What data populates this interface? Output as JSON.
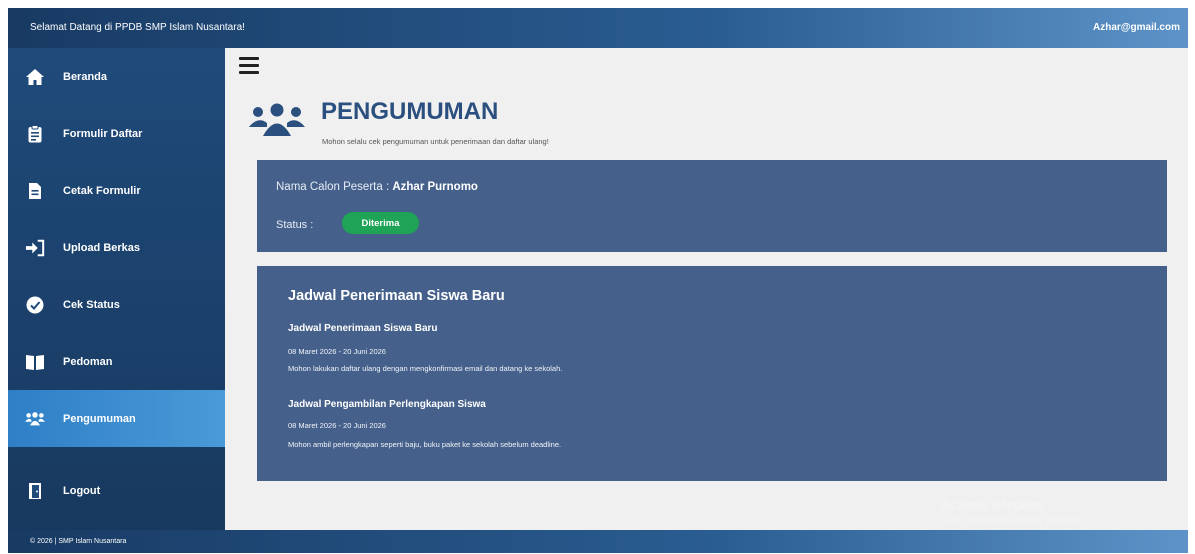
{
  "topbar": {
    "welcome": "Selamat Datang di PPDB SMP Islam Nusantara!",
    "email": "Azhar@gmail.com"
  },
  "sidebar": {
    "items": [
      {
        "label": "Beranda",
        "icon": "home-icon"
      },
      {
        "label": "Formulir Daftar",
        "icon": "form-icon"
      },
      {
        "label": "Cetak Formulir",
        "icon": "document-icon"
      },
      {
        "label": "Upload Berkas",
        "icon": "sign-in-icon"
      },
      {
        "label": "Cek Status",
        "icon": "check-circle-icon"
      },
      {
        "label": "Pedoman",
        "icon": "book-icon"
      },
      {
        "label": "Pengumuman",
        "icon": "users-icon",
        "active": true
      },
      {
        "label": "Logout",
        "icon": "door-icon"
      }
    ]
  },
  "header": {
    "title": "PENGUMUMAN",
    "subtitle": "Mohon selalu cek pengumuman untuk penerimaan dan daftar ulang!"
  },
  "applicant": {
    "name_label": "Nama Calon Peserta : ",
    "name": "Azhar Purnomo",
    "status_label": "Status :",
    "status": "Diterima",
    "status_color": "#1fa356"
  },
  "schedule": {
    "title": "Jadwal Penerimaan Siswa Baru",
    "items": [
      {
        "title": "Jadwal Penerimaan Siswa Baru",
        "date": "08 Maret 2026 - 20 Juni 2026",
        "desc": "Mohon lakukan daftar ulang dengan mengkonfirmasi email dan datang ke sekolah."
      },
      {
        "title": "Jadwal Pengambilan Perlengkapan Siswa",
        "date": "08 Maret 2026 - 20 Juni 2026",
        "desc": "Mohon ambil perlengkapan seperti baju, buku paket ke sekolah sebelum deadline."
      }
    ]
  },
  "watermark": {
    "line1": "Activate Windows",
    "line2": "Go to Settings to activate Windows."
  },
  "footer": {
    "copyright": "© 2026 | SMP Islam Nusantara"
  },
  "colors": {
    "sidebar": "#1f4a7a",
    "active": "#2f7fc7",
    "card": "#45608a",
    "title": "#2b4f7e"
  }
}
